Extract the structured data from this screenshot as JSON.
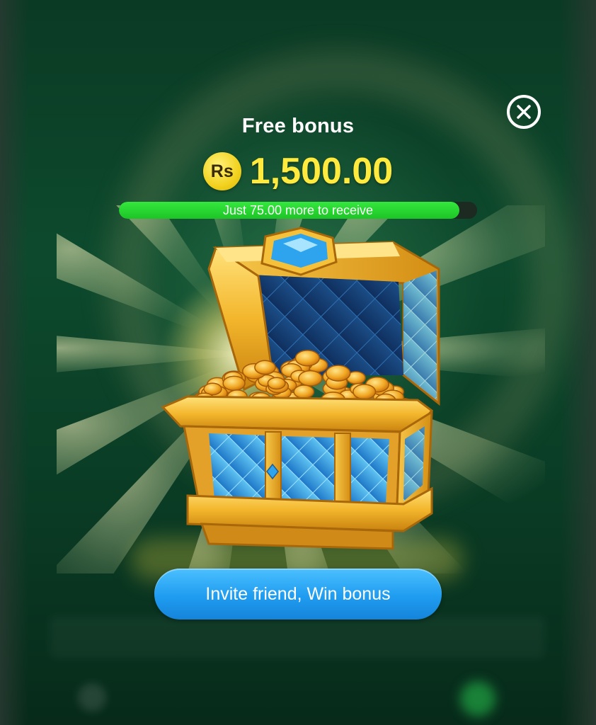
{
  "dialog": {
    "title": "Free bonus",
    "currency_symbol": "Rs",
    "amount": "1,500.00",
    "progress": {
      "text": "Just 75.00 more to receive",
      "fraction": 0.95
    },
    "invite_button_label": "Invite friend, Win bonus",
    "close_icon": "close-icon",
    "reward_image": "treasure-chest-icon"
  },
  "colors": {
    "amount": "#ffea3d",
    "progress_fill": "#22cc2a",
    "button": "#1f9cf0",
    "background": "#0d4a2d"
  }
}
